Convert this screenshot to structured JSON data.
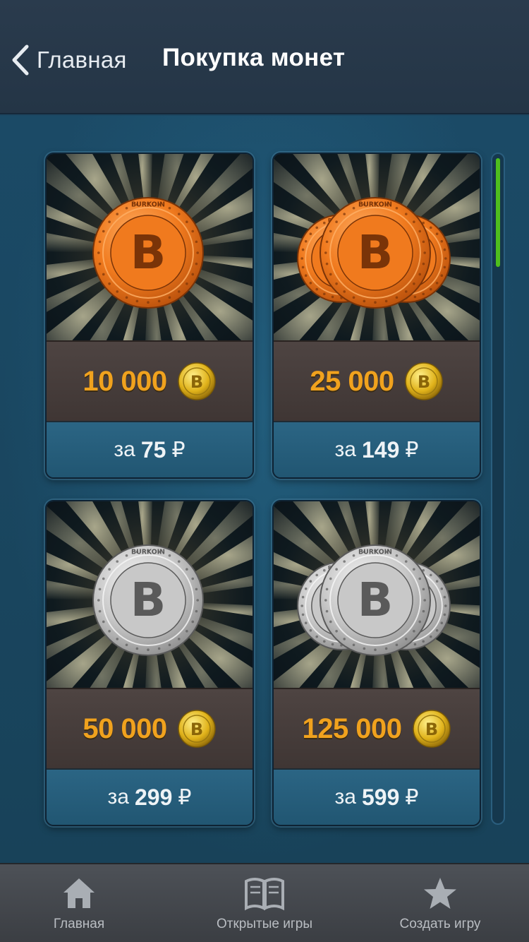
{
  "header": {
    "back_label": "Главная",
    "title": "Покупка монет"
  },
  "packages": [
    {
      "amount": "10 000",
      "price_prefix": "за",
      "price": "75",
      "currency": "₽",
      "coin_type": "bronze",
      "coin_count": 1,
      "coin_text": "BURKOIN"
    },
    {
      "amount": "25 000",
      "price_prefix": "за",
      "price": "149",
      "currency": "₽",
      "coin_type": "bronze",
      "coin_count": 3,
      "coin_text": "BURKOIN"
    },
    {
      "amount": "50 000",
      "price_prefix": "за",
      "price": "299",
      "currency": "₽",
      "coin_type": "silver",
      "coin_count": 1,
      "coin_text": "BURKOIN"
    },
    {
      "amount": "125 000",
      "price_prefix": "за",
      "price": "599",
      "currency": "₽",
      "coin_type": "silver",
      "coin_count": 3,
      "coin_text": "BURKOIN"
    }
  ],
  "scrollbar": {
    "position": 0,
    "visible_fraction": 0.16
  },
  "tabbar": {
    "items": [
      {
        "label": "Главная",
        "icon": "home-icon"
      },
      {
        "label": "Открытые игры",
        "icon": "book-icon"
      },
      {
        "label": "Создать игру",
        "icon": "star-icon"
      }
    ]
  },
  "colors": {
    "accent_gold": "#f0a21e",
    "scroll_thumb": "#4fbf1d",
    "background": "#1c4660"
  }
}
